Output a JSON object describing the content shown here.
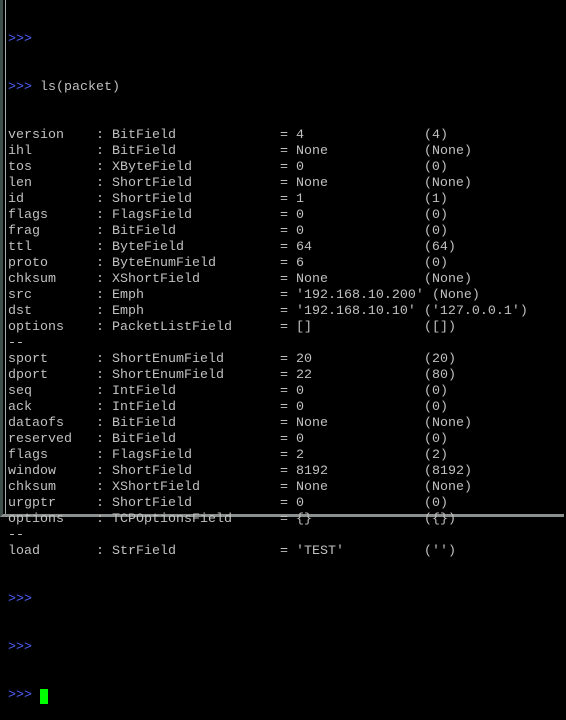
{
  "prompt": ">>>",
  "command": "ls(packet)",
  "rows": [
    {
      "name": "version",
      "type": "BitField",
      "value": "4",
      "default": "(4)"
    },
    {
      "name": "ihl",
      "type": "BitField",
      "value": "None",
      "default": "(None)"
    },
    {
      "name": "tos",
      "type": "XByteField",
      "value": "0",
      "default": "(0)"
    },
    {
      "name": "len",
      "type": "ShortField",
      "value": "None",
      "default": "(None)"
    },
    {
      "name": "id",
      "type": "ShortField",
      "value": "1",
      "default": "(1)"
    },
    {
      "name": "flags",
      "type": "FlagsField",
      "value": "0",
      "default": "(0)"
    },
    {
      "name": "frag",
      "type": "BitField",
      "value": "0",
      "default": "(0)"
    },
    {
      "name": "ttl",
      "type": "ByteField",
      "value": "64",
      "default": "(64)"
    },
    {
      "name": "proto",
      "type": "ByteEnumField",
      "value": "6",
      "default": "(0)"
    },
    {
      "name": "chksum",
      "type": "XShortField",
      "value": "None",
      "default": "(None)"
    },
    {
      "name": "src",
      "type": "Emph",
      "value": "'192.168.10.200'",
      "default": "(None)"
    },
    {
      "name": "dst",
      "type": "Emph",
      "value": "'192.168.10.10'",
      "default": "('127.0.0.1')"
    },
    {
      "name": "options",
      "type": "PacketListField",
      "value": "[]",
      "default": "([])"
    },
    {
      "separator": "--"
    },
    {
      "name": "sport",
      "type": "ShortEnumField",
      "value": "20",
      "default": "(20)"
    },
    {
      "name": "dport",
      "type": "ShortEnumField",
      "value": "22",
      "default": "(80)"
    },
    {
      "name": "seq",
      "type": "IntField",
      "value": "0",
      "default": "(0)"
    },
    {
      "name": "ack",
      "type": "IntField",
      "value": "0",
      "default": "(0)"
    },
    {
      "name": "dataofs",
      "type": "BitField",
      "value": "None",
      "default": "(None)"
    },
    {
      "name": "reserved",
      "type": "BitField",
      "value": "0",
      "default": "(0)"
    },
    {
      "name": "flags",
      "type": "FlagsField",
      "value": "2",
      "default": "(2)"
    },
    {
      "name": "window",
      "type": "ShortField",
      "value": "8192",
      "default": "(8192)"
    },
    {
      "name": "chksum",
      "type": "XShortField",
      "value": "None",
      "default": "(None)"
    },
    {
      "name": "urgptr",
      "type": "ShortField",
      "value": "0",
      "default": "(0)"
    },
    {
      "name": "options",
      "type": "TCPOptionsField",
      "value": "{}",
      "default": "({})"
    },
    {
      "separator": "--"
    },
    {
      "name": "load",
      "type": "StrField",
      "value": "'TEST'",
      "default": "('')"
    }
  ],
  "colors": {
    "prompt": "#5060ff",
    "text": "#c0c0c0",
    "cursor": "#00ff00",
    "background": "#000000"
  }
}
